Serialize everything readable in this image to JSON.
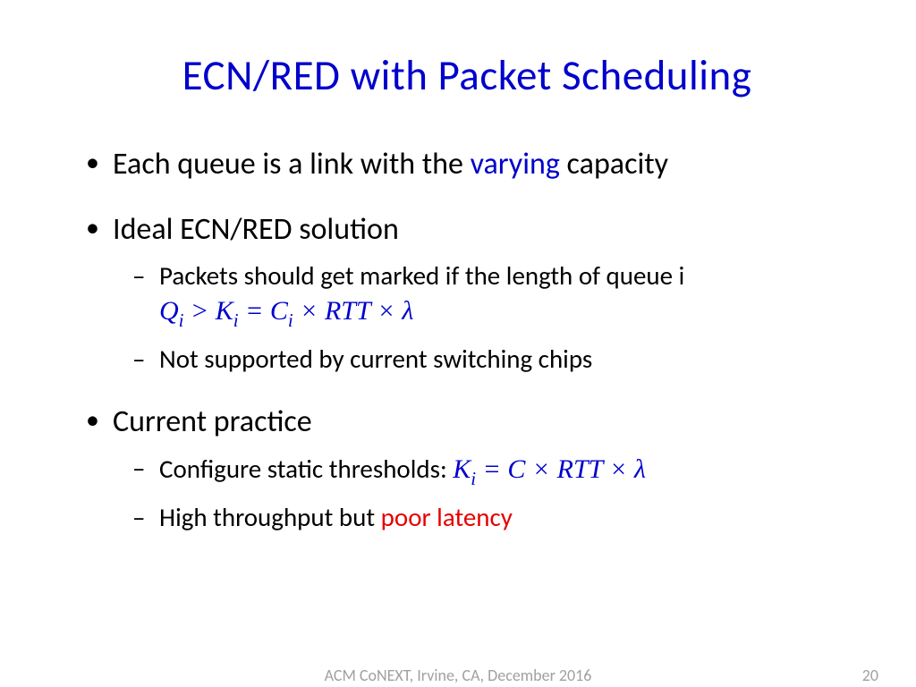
{
  "title": "ECN/RED with Packet Scheduling",
  "b1_pre": "Each queue is a link with the ",
  "b1_hl": "varying",
  "b1_post": " capacity",
  "b2": "Ideal ECN/RED solution",
  "b2s1": "Packets should get marked if the length of queue i",
  "b2s1_formula": "Qᵢ > Kᵢ = Cᵢ × RTT × λ",
  "b2s2": "Not supported by current switching chips",
  "b3": "Current practice",
  "b3s1_pre": "Configure static thresholds: ",
  "b3s1_formula": "Kᵢ = C × RTT × λ",
  "b3s2_pre": "High throughput but ",
  "b3s2_hl": "poor latency",
  "footer_center": "ACM CoNEXT, Irvine, CA, December 2016",
  "footer_right": "20"
}
